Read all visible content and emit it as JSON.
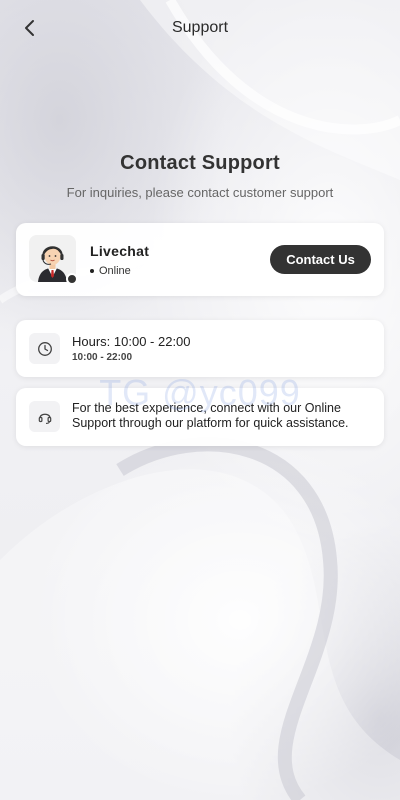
{
  "header": {
    "title": "Support",
    "back_icon": "chevron-left-icon"
  },
  "intro": {
    "title": "Contact Support",
    "subtitle": "For inquiries, please contact customer support"
  },
  "livechat": {
    "name": "Livechat",
    "status": "Online",
    "button_label": "Contact Us",
    "avatar_icon": "support-agent-avatar"
  },
  "hours": {
    "main": "Hours: 10:00 - 22:00",
    "sub": "10:00 - 22:00",
    "icon": "clock-icon"
  },
  "info": {
    "text": "For the best experience, connect with our Online Support through our platform for quick assistance.",
    "icon": "headset-icon"
  },
  "watermark": "TG @yc099",
  "colors": {
    "button_bg": "#333333",
    "background": "#eeeef2",
    "watermark": "#7896e1"
  }
}
